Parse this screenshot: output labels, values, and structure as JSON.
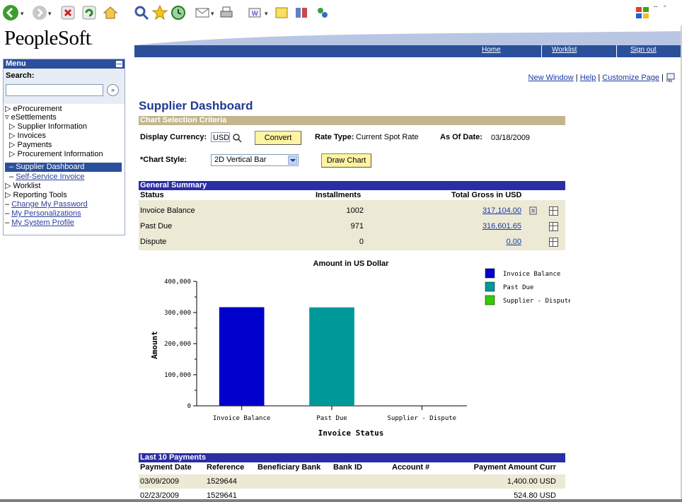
{
  "header": {
    "logo": "PeopleSoft",
    "links": [
      "Home",
      "Worklist",
      "Sign out"
    ]
  },
  "menu": {
    "title": "Menu",
    "search_label": "Search:",
    "items": [
      {
        "label": "eProcurement",
        "kind": "collapsed"
      },
      {
        "label": "eSettlements",
        "kind": "expanded"
      },
      {
        "label": "Supplier Information",
        "kind": "sub-collapsed"
      },
      {
        "label": "Invoices",
        "kind": "sub-collapsed"
      },
      {
        "label": "Payments",
        "kind": "sub-collapsed"
      },
      {
        "label": "Procurement Information",
        "kind": "sub-collapsed"
      },
      {
        "label": "Supplier Dashboard",
        "kind": "active"
      },
      {
        "label": "Self-Service Invoice",
        "kind": "link"
      },
      {
        "label": "Worklist",
        "kind": "collapsed"
      },
      {
        "label": "Reporting Tools",
        "kind": "collapsed"
      },
      {
        "label": "Change My Password",
        "kind": "toplink"
      },
      {
        "label": "My Personalizations",
        "kind": "toplink"
      },
      {
        "label": "My System Profile",
        "kind": "toplink"
      }
    ]
  },
  "toplinks": [
    "New Window",
    "Help",
    "Customize Page"
  ],
  "page": {
    "title": "Supplier Dashboard",
    "criteria_header": "Chart Selection Criteria",
    "currency_label": "Display Currency:",
    "currency_value": "USD",
    "convert_label": "Convert",
    "rate_type_label": "Rate Type:",
    "rate_type_value": "Current Spot Rate",
    "as_of_label": "As Of Date:",
    "as_of_value": "03/18/2009",
    "chart_style_label": "*Chart Style:",
    "chart_style_value": "2D Vertical Bar",
    "draw_chart_label": "Draw Chart"
  },
  "summary": {
    "header": "General Summary",
    "columns": [
      "Status",
      "Installments",
      "Total Gross in USD"
    ],
    "rows": [
      {
        "status": "Invoice Balance",
        "installments": "1002",
        "total": "317,104.00"
      },
      {
        "status": "Past Due",
        "installments": "971",
        "total": "316,601.65"
      },
      {
        "status": "Dispute",
        "installments": "0",
        "total": "0.00"
      }
    ]
  },
  "chart_data": {
    "type": "bar",
    "title": "Amount in US Dollar",
    "xlabel": "Invoice Status",
    "ylabel": "Amount",
    "categories": [
      "Invoice Balance",
      "Past Due",
      "Supplier - Dispute"
    ],
    "values": [
      317104.0,
      316601.65,
      0
    ],
    "colors": [
      "#0000cc",
      "#009999",
      "#33cc00"
    ],
    "ylim": [
      0,
      400000
    ],
    "yticks": [
      "0",
      "100,000",
      "200,000",
      "300,000",
      "400,000"
    ],
    "legend": [
      "Invoice Balance",
      "Past Due",
      "Supplier - Dispute"
    ],
    "legend_position": "top-right"
  },
  "payments": {
    "header": "Last 10 Payments",
    "columns": [
      "Payment Date",
      "Reference",
      "Beneficiary Bank",
      "Bank ID",
      "Account #",
      "Payment Amount Curr"
    ],
    "rows": [
      {
        "date": "03/09/2009",
        "reference": "1529644",
        "amount": "1,400.00 USD"
      },
      {
        "date": "02/23/2009",
        "reference": "1529641",
        "amount": "524.80 USD"
      }
    ]
  }
}
